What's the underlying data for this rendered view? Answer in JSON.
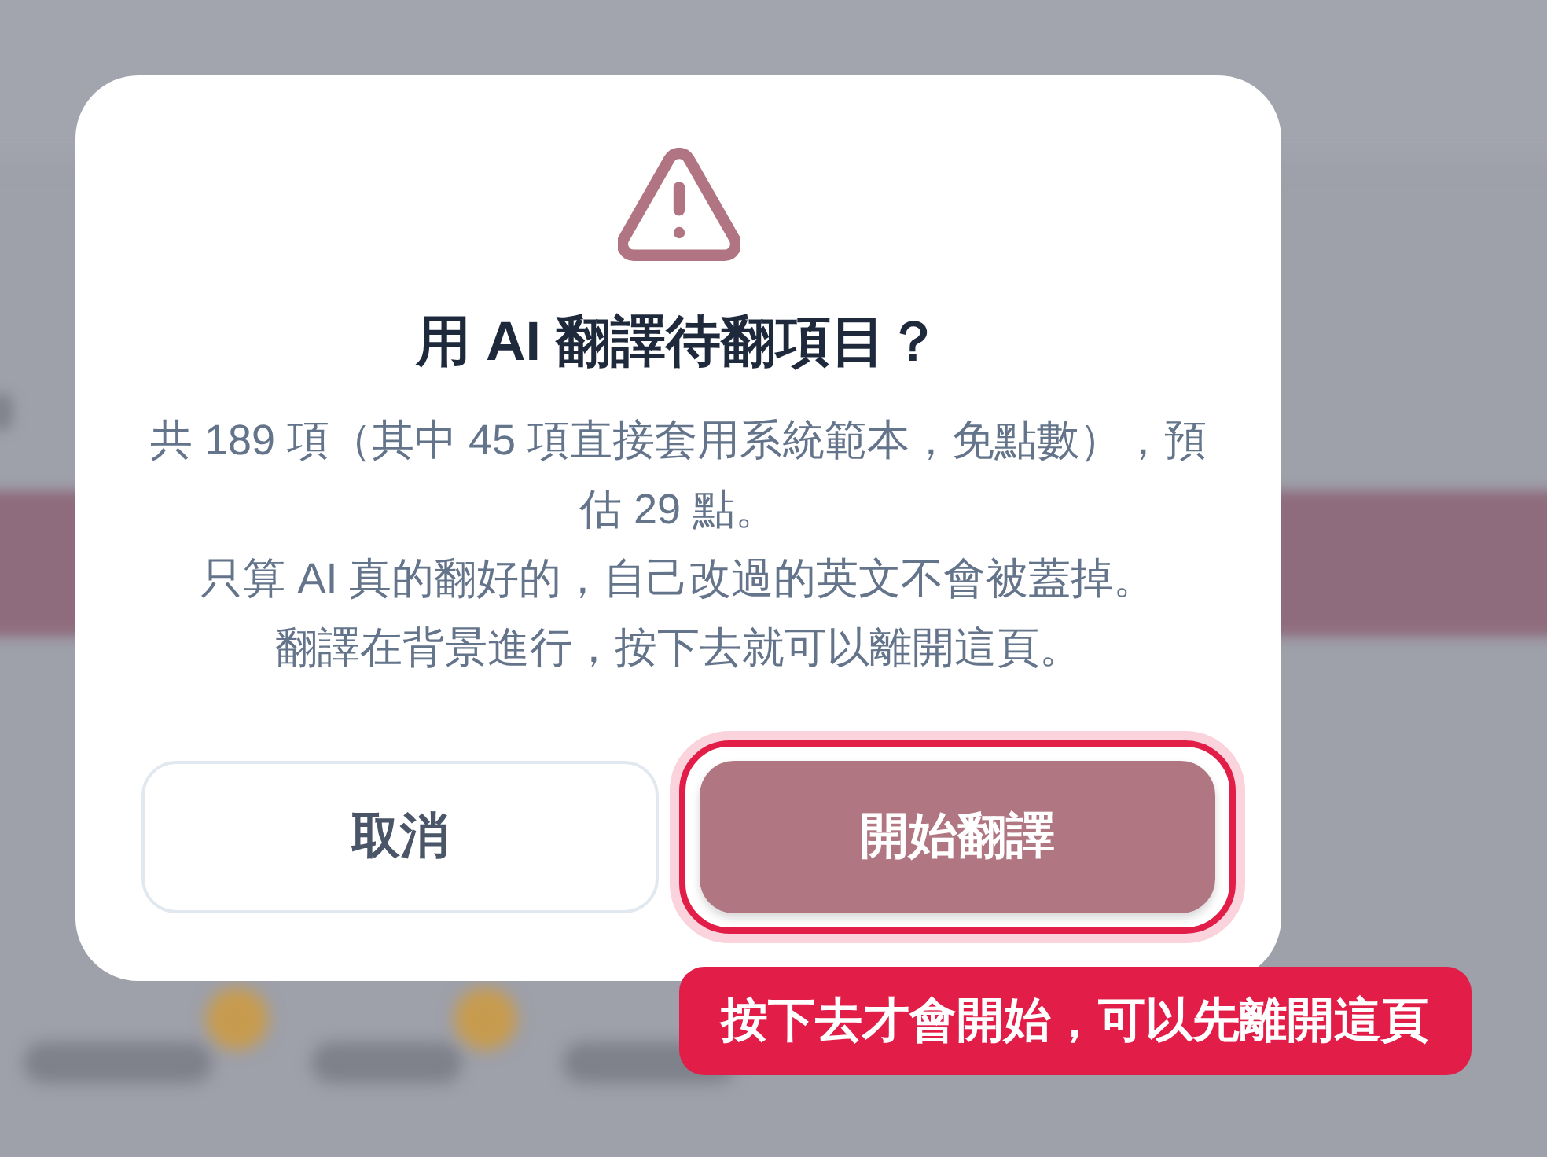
{
  "dialog": {
    "title": "用 AI 翻譯待翻項目？",
    "paragraphs": [
      "共 189 項（其中 45 項直接套用系統範本，免點數），預估 29 點。",
      "只算 AI 真的翻好的，自己改過的英文不會被蓋掉。",
      "翻譯在背景進行，按下去就可以離開這頁。"
    ],
    "buttons": [
      {
        "label": "取消",
        "kind": "secondary",
        "highlighted": false
      },
      {
        "label": "開始翻譯",
        "kind": "primary",
        "highlighted": true,
        "coach_tip": "按下去才會開始，可以先離開這頁"
      }
    ]
  }
}
